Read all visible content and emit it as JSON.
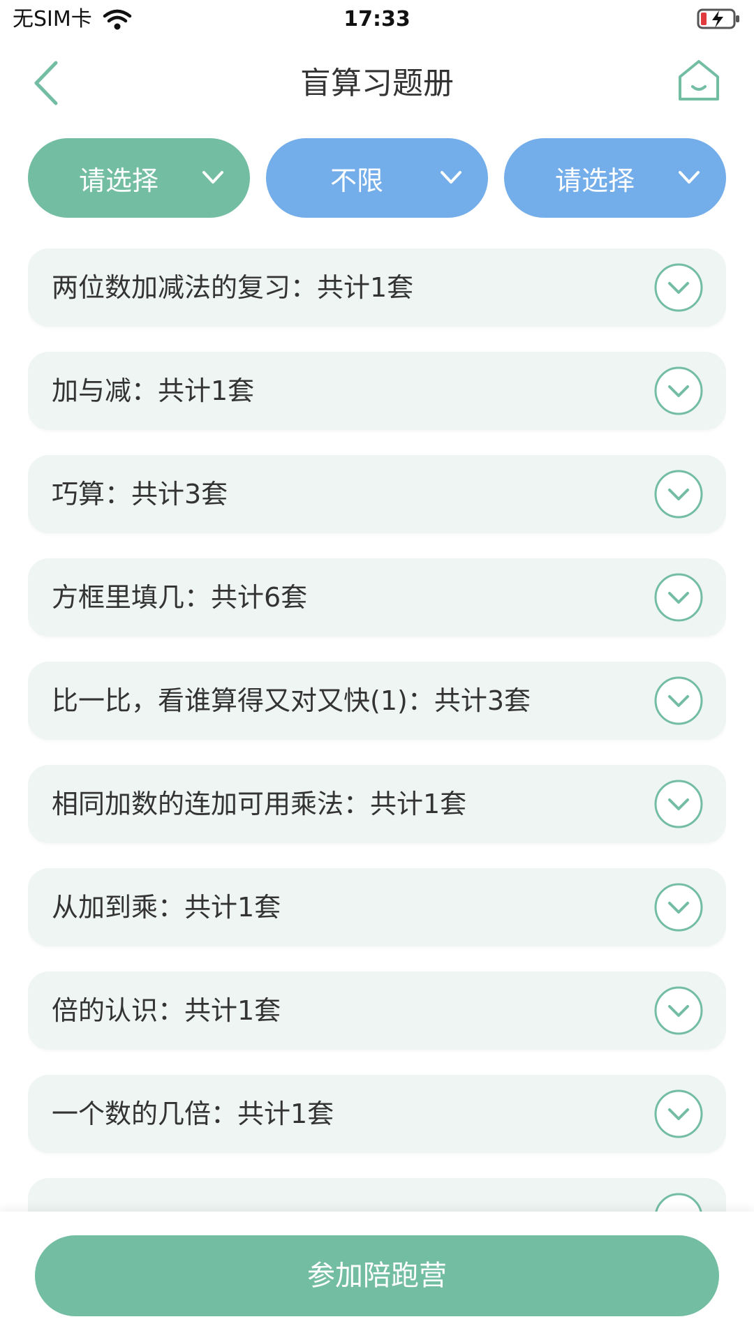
{
  "status_bar": {
    "carrier": "无SIM卡",
    "time": "17:33"
  },
  "nav": {
    "title": "盲算习题册",
    "back_icon": "back-chevron-icon",
    "home_icon": "home-icon"
  },
  "filters": [
    {
      "label": "请选择",
      "color": "#73bda3"
    },
    {
      "label": "不限",
      "color": "#74aeea"
    },
    {
      "label": "请选择",
      "color": "#74aeea"
    }
  ],
  "items": [
    {
      "label": "两位数加减法的复习：共计1套"
    },
    {
      "label": "加与减：共计1套"
    },
    {
      "label": "巧算：共计3套"
    },
    {
      "label": "方框里填几：共计6套"
    },
    {
      "label": "比一比，看谁算得又对又快(1)：共计3套"
    },
    {
      "label": "相同加数的连加可用乘法：共计1套"
    },
    {
      "label": "从加到乘：共计1套"
    },
    {
      "label": "倍的认识：共计1套"
    },
    {
      "label": "一个数的几倍：共计1套"
    },
    {
      "label": ""
    }
  ],
  "bottom": {
    "button_label": "参加陪跑营"
  },
  "colors": {
    "accent_green": "#73bda3",
    "accent_blue": "#74aeea",
    "item_bg": "#eef5f3"
  }
}
